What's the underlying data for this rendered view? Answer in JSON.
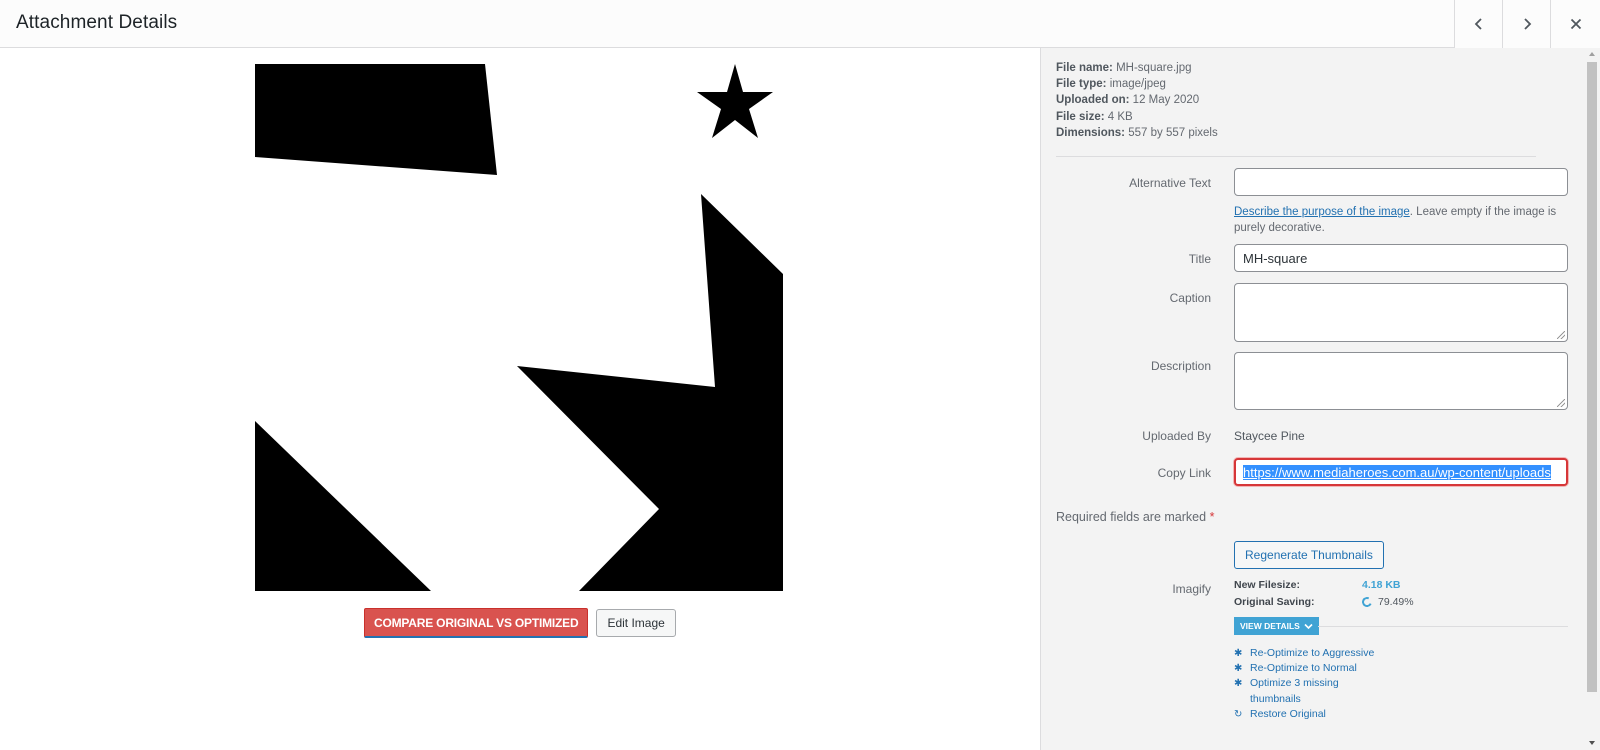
{
  "header": {
    "title": "Attachment Details",
    "prev_icon": "chevron-left-icon",
    "next_icon": "chevron-right-icon",
    "close_icon": "close-icon"
  },
  "media": {
    "compare_label": "COMPARE ORIGINAL VS OPTIMIZED",
    "edit_label": "Edit Image"
  },
  "file_info": {
    "file_name_label": "File name:",
    "file_name": "MH-square.jpg",
    "file_type_label": "File type:",
    "file_type": "image/jpeg",
    "uploaded_on_label": "Uploaded on:",
    "uploaded_on": "12 May 2020",
    "file_size_label": "File size:",
    "file_size": "4 KB",
    "dimensions_label": "Dimensions:",
    "dimensions": "557 by 557 pixels"
  },
  "form": {
    "alt_text_label": "Alternative Text",
    "alt_text_value": "",
    "alt_help_link": "Describe the purpose of the image",
    "alt_help_text": ". Leave empty if the image is purely decorative.",
    "title_label": "Title",
    "title_value": "MH-square",
    "caption_label": "Caption",
    "caption_value": "",
    "description_label": "Description",
    "description_value": "",
    "uploaded_by_label": "Uploaded By",
    "uploaded_by_value": "Staycee Pine",
    "copy_link_label": "Copy Link",
    "copy_link_value": "https://www.mediaheroes.com.au/wp-content/uploads",
    "required_text": "Required fields are marked",
    "required_star": "*",
    "regenerate_label": "Regenerate Thumbnails"
  },
  "imagify": {
    "label": "Imagify",
    "new_filesize_label": "New Filesize:",
    "new_filesize_value": "4.18 KB",
    "original_saving_label": "Original Saving:",
    "original_saving_value": "79.49%",
    "view_details_label": "VIEW DETAILS",
    "actions": [
      {
        "icon": "gear-icon",
        "label": "Re-Optimize to Aggressive"
      },
      {
        "icon": "gear-icon",
        "label": "Re-Optimize to Normal"
      },
      {
        "icon": "gear-icon",
        "label": "Optimize 3 missing thumbnails"
      },
      {
        "icon": "restore-icon",
        "label": "Restore Original"
      }
    ]
  },
  "colors": {
    "accent": "#2271b1",
    "imagify_blue": "#40a3d4",
    "compare_red": "#d9534f",
    "focus_red": "#d63638"
  }
}
